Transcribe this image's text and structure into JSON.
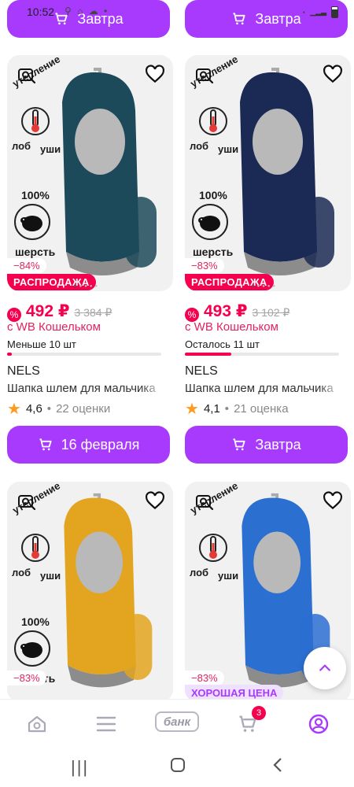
{
  "status_bar": {
    "time": "10:52"
  },
  "top_buttons": [
    {
      "label": "Завтра"
    },
    {
      "label": "Завтра"
    }
  ],
  "products": [
    {
      "badge_top": "утепление",
      "badge_left": "лоб",
      "badge_right": "уши",
      "wool_percent": "100%",
      "wool_label": "шерсть",
      "discount": "−84%",
      "tag": "РАСПРОДАЖА",
      "price": "492 ₽",
      "old_price": "3 384 ₽",
      "wallet": "с WB Кошельком",
      "stock": "Меньше 10 шт",
      "stock_fill": 0.03,
      "brand": "NELS",
      "name": "Шапка шлем для мальчика",
      "rating": "4,6",
      "reviews": "22 оценки",
      "delivery": "16 февраля",
      "color": "#1d4a5a"
    },
    {
      "badge_top": "утепление",
      "badge_left": "лоб",
      "badge_right": "уши",
      "wool_percent": "100%",
      "wool_label": "шерсть",
      "discount": "−83%",
      "tag": "РАСПРОДАЖА",
      "price": "493 ₽",
      "old_price": "3 102 ₽",
      "wallet": "с WB Кошельком",
      "stock": "Осталось 11 шт",
      "stock_fill": 0.3,
      "brand": "NELS",
      "name": "Шапка шлем для мальчика",
      "rating": "4,1",
      "reviews": "21 оценка",
      "delivery": "Завтра",
      "color": "#1b2a55"
    },
    {
      "badge_top": "утепление",
      "badge_left": "лоб",
      "badge_right": "уши",
      "wool_percent": "100%",
      "wool_label": "шерсть",
      "discount": "−83%",
      "color": "#e3a51f"
    },
    {
      "badge_top": "утепление",
      "badge_left": "лоб",
      "badge_right": "уши",
      "discount": "−83%",
      "tag": "ХОРОШАЯ ЦЕНА",
      "color": "#2b6fd1"
    }
  ],
  "bottom_nav": {
    "bank_label": "банк",
    "cart_count": "3"
  },
  "colors": {
    "accent": "#a73afd",
    "sale": "#f5004f"
  }
}
